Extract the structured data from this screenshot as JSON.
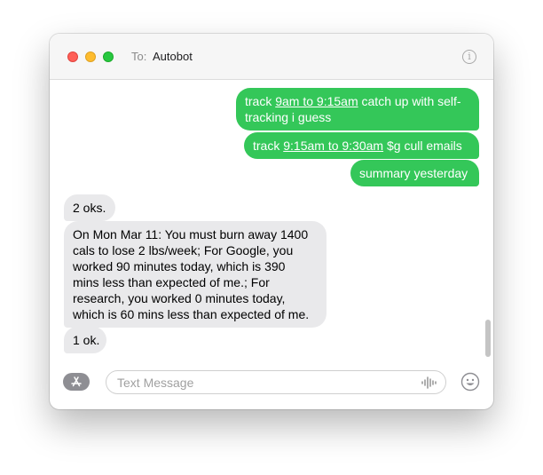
{
  "header": {
    "to_label": "To:",
    "recipient": "Autobot",
    "info_icon": "info-icon"
  },
  "messages": [
    {
      "direction": "outgoing",
      "parts": [
        "track ",
        "9am to 9:15am",
        " catch up with self-",
        "tracking i guess"
      ]
    },
    {
      "direction": "outgoing",
      "parts": [
        "track ",
        "9:15am to 9:30am",
        " $g cull emails"
      ]
    },
    {
      "direction": "outgoing",
      "text": "summary yesterday"
    },
    {
      "direction": "incoming",
      "text": "2 oks."
    },
    {
      "direction": "incoming",
      "lines": [
        "On Mon Mar 11: You must burn away 1400",
        "cals to lose 2 lbs/week; For Google, you",
        "worked 90 minutes today, which is 390",
        "mins less than expected of me.; For",
        "research, you worked 0 minutes today,",
        "which is 60 mins less than expected of me."
      ]
    },
    {
      "direction": "incoming",
      "text": "1 ok."
    }
  ],
  "composer": {
    "placeholder": "Text Message",
    "apps_icon": "app-store-icon",
    "audio_icon": "audio-waveform-icon",
    "emoji_icon": "emoji-icon"
  },
  "colors": {
    "outgoing_bubble": "#34c759",
    "incoming_bubble": "#e9e9eb"
  }
}
